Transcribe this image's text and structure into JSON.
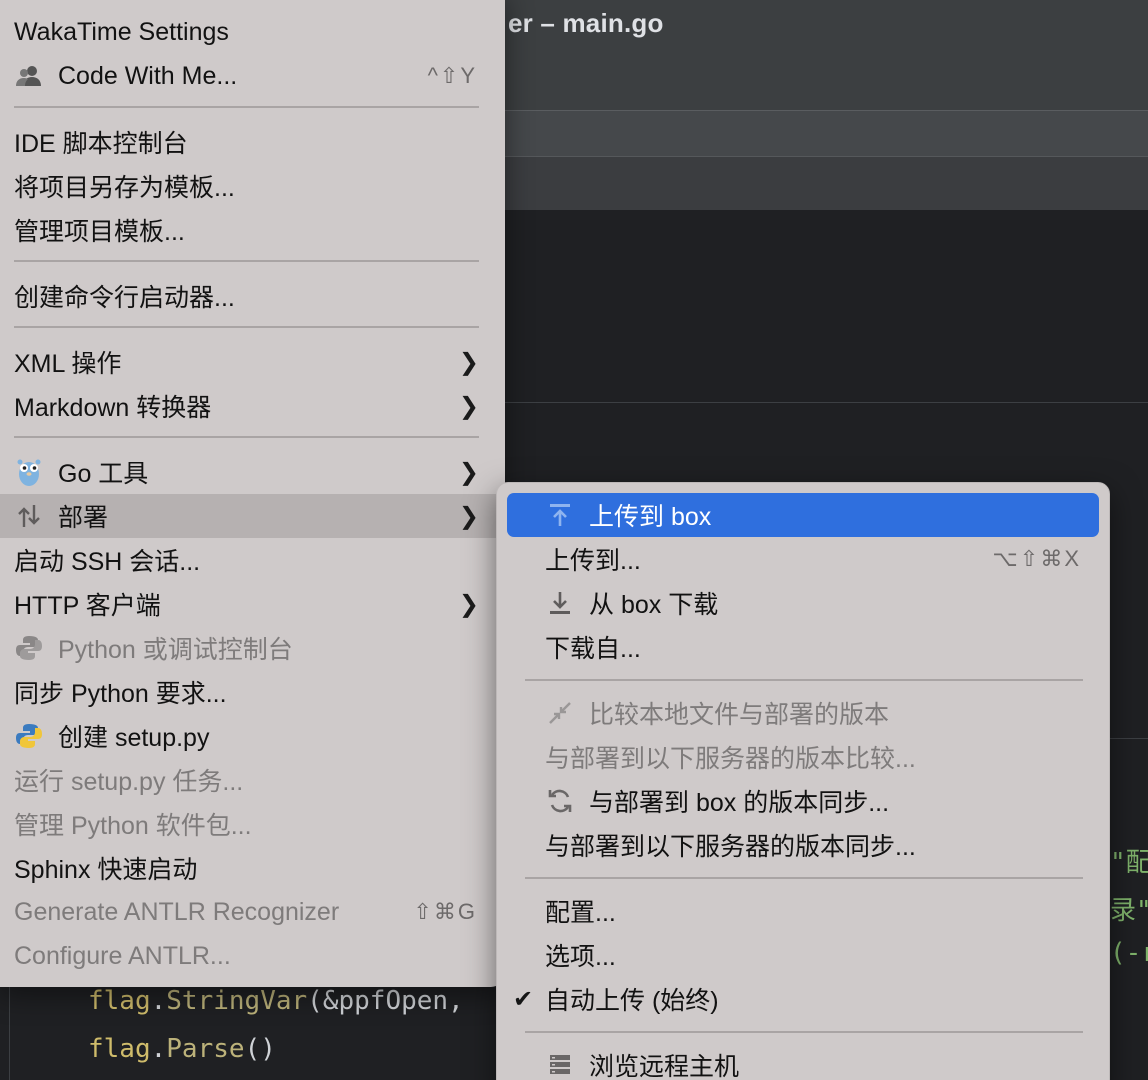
{
  "window": {
    "title_fragment": "er – main.go"
  },
  "code_lines": [
    {
      "obj": "flag",
      "dot": ".",
      "fn": "StringVar",
      "args": "(&ppfOpen,"
    },
    {
      "obj": "flag",
      "dot": ".",
      "fn": "Parse",
      "args": "()"
    }
  ],
  "code_fragments": {
    "f1": "\"配",
    "f2": "录\")",
    "f3": "(-r"
  },
  "left_menu": {
    "items": [
      {
        "label": "WakaTime Settings"
      },
      {
        "label": "Code With Me...",
        "shortcut": "^⇧Y",
        "icon": "users-icon"
      },
      {
        "label": "IDE 脚本控制台"
      },
      {
        "label": "将项目另存为模板..."
      },
      {
        "label": "管理项目模板..."
      },
      {
        "label": "创建命令行启动器..."
      },
      {
        "label": "XML 操作"
      },
      {
        "label": "Markdown 转换器"
      },
      {
        "label": "Go 工具",
        "icon": "gopher-icon"
      },
      {
        "label": "部署",
        "icon": "deploy-arrows-icon"
      },
      {
        "label": "启动 SSH 会话..."
      },
      {
        "label": "HTTP 客户端"
      },
      {
        "label": "Python 或调试控制台",
        "icon": "python-gray-icon"
      },
      {
        "label": "同步 Python 要求..."
      },
      {
        "label": "创建 setup.py",
        "icon": "python-icon"
      },
      {
        "label": "运行 setup.py 任务..."
      },
      {
        "label": "管理 Python 软件包..."
      },
      {
        "label": "Sphinx 快速启动"
      },
      {
        "label": "Generate ANTLR Recognizer",
        "shortcut": "⇧⌘G"
      },
      {
        "label": "Configure ANTLR..."
      }
    ]
  },
  "right_menu": {
    "items": [
      {
        "label": "上传到 box",
        "icon": "upload-icon"
      },
      {
        "label": "上传到...",
        "shortcut": "⌥⇧⌘X"
      },
      {
        "label": "从 box 下载",
        "icon": "download-icon"
      },
      {
        "label": "下载自..."
      },
      {
        "label": "比较本地文件与部署的版本",
        "icon": "compare-icon"
      },
      {
        "label": "与部署到以下服务器的版本比较..."
      },
      {
        "label": "与部署到 box 的版本同步...",
        "icon": "sync-icon"
      },
      {
        "label": "与部署到以下服务器的版本同步..."
      },
      {
        "label": "配置..."
      },
      {
        "label": "选项..."
      },
      {
        "label": "自动上传 (始终)",
        "checked": true
      },
      {
        "label": "浏览远程主机",
        "icon": "server-icon"
      }
    ]
  },
  "colors": {
    "highlight": "#2f6fde",
    "menu_bg": "#cfcaca"
  }
}
